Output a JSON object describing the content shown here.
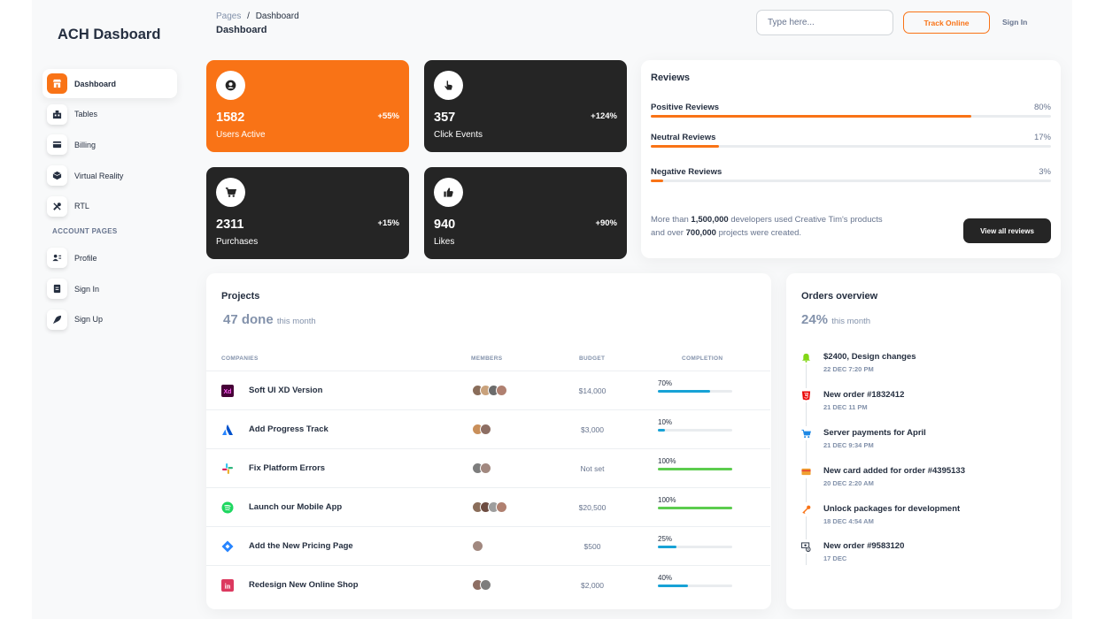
{
  "brand": "ACH Dasboard",
  "breadcrumb": {
    "root": "Pages",
    "separator": "/",
    "current": "Dashboard"
  },
  "page_title": "Dashboard",
  "header": {
    "search_placeholder": "Type here...",
    "track_label": "Track Online",
    "signin_label": "Sign In"
  },
  "sidebar": {
    "items": [
      {
        "label": "Dashboard",
        "icon": "shop-icon"
      },
      {
        "label": "Tables",
        "icon": "office-icon"
      },
      {
        "label": "Billing",
        "icon": "credit-card-icon"
      },
      {
        "label": "Virtual Reality",
        "icon": "box-icon"
      },
      {
        "label": "RTL",
        "icon": "settings-icon"
      }
    ],
    "account_heading": "ACCOUNT PAGES",
    "account_items": [
      {
        "label": "Profile",
        "icon": "customer-support-icon"
      },
      {
        "label": "Sign In",
        "icon": "document-icon"
      },
      {
        "label": "Sign Up",
        "icon": "spaceship-icon"
      }
    ]
  },
  "stats": [
    {
      "value": "1582",
      "label": "Users Active",
      "change": "+55%",
      "icon": "user-icon"
    },
    {
      "value": "357",
      "label": "Click Events",
      "change": "+124%",
      "icon": "pointer-icon"
    },
    {
      "value": "2311",
      "label": "Purchases",
      "change": "+15%",
      "icon": "cart-icon"
    },
    {
      "value": "940",
      "label": "Likes",
      "change": "+90%",
      "icon": "thumbs-up-icon"
    }
  ],
  "reviews": {
    "title": "Reviews",
    "items": [
      {
        "label": "Positive Reviews",
        "pct_label": "80%",
        "value": 80
      },
      {
        "label": "Neutral Reviews",
        "pct_label": "17%",
        "value": 17
      },
      {
        "label": "Negative Reviews",
        "pct_label": "3%",
        "value": 3
      }
    ],
    "text_pre": "More than ",
    "text_b1": "1,500,000",
    "text_mid": " developers used Creative Tim's products and over ",
    "text_b2": "700,000",
    "text_post": " projects were created.",
    "button": "View all reviews"
  },
  "projects": {
    "title": "Projects",
    "count": "47 done",
    "count_suffix": "this month",
    "columns": [
      "COMPANIES",
      "MEMBERS",
      "BUDGET",
      "COMPLETION"
    ],
    "rows": [
      {
        "name": "Soft UI XD Version",
        "logo": "xd-logo-icon",
        "members": 4,
        "budget": "$14,000",
        "completion_label": "70%",
        "completion": 70
      },
      {
        "name": "Add Progress Track",
        "logo": "atlassian-logo-icon",
        "members": 2,
        "budget": "$3,000",
        "completion_label": "10%",
        "completion": 10
      },
      {
        "name": "Fix Platform Errors",
        "logo": "slack-logo-icon",
        "members": 2,
        "budget": "Not set",
        "completion_label": "100%",
        "completion": 100
      },
      {
        "name": "Launch our Mobile App",
        "logo": "spotify-logo-icon",
        "members": 4,
        "budget": "$20,500",
        "completion_label": "100%",
        "completion": 100
      },
      {
        "name": "Add the New Pricing Page",
        "logo": "jira-logo-icon",
        "members": 1,
        "budget": "$500",
        "completion_label": "25%",
        "completion": 25
      },
      {
        "name": "Redesign New Online Shop",
        "logo": "invision-logo-icon",
        "members": 2,
        "budget": "$2,000",
        "completion_label": "40%",
        "completion": 40
      }
    ]
  },
  "orders": {
    "title": "Orders overview",
    "pct": "24%",
    "pct_suffix": "this month",
    "items": [
      {
        "title": "$2400, Design changes",
        "date": "22 DEC 7:20 PM",
        "icon": "bell-icon",
        "color": "#82d616"
      },
      {
        "title": "New order #1832412",
        "date": "21 DEC 11 PM",
        "icon": "html5-icon",
        "color": "#ea0606"
      },
      {
        "title": "Server payments for April",
        "date": "21 DEC 9:34 PM",
        "icon": "cart-icon",
        "color": "#17c1e8"
      },
      {
        "title": "New card added for order #4395133",
        "date": "20 DEC 2:20 AM",
        "icon": "credit-card-icon",
        "color": "#f53939"
      },
      {
        "title": "Unlock packages for development",
        "date": "18 DEC 4:54 AM",
        "icon": "key-icon",
        "color": "#f97316"
      },
      {
        "title": "New order #9583120",
        "date": "17 DEC",
        "icon": "money-icon",
        "color": "#252f40"
      }
    ]
  },
  "colors": {
    "accent": "#f97316",
    "dark": "#252525",
    "progress_blue": "#17a2d6",
    "progress_green": "#5ccc4e"
  }
}
